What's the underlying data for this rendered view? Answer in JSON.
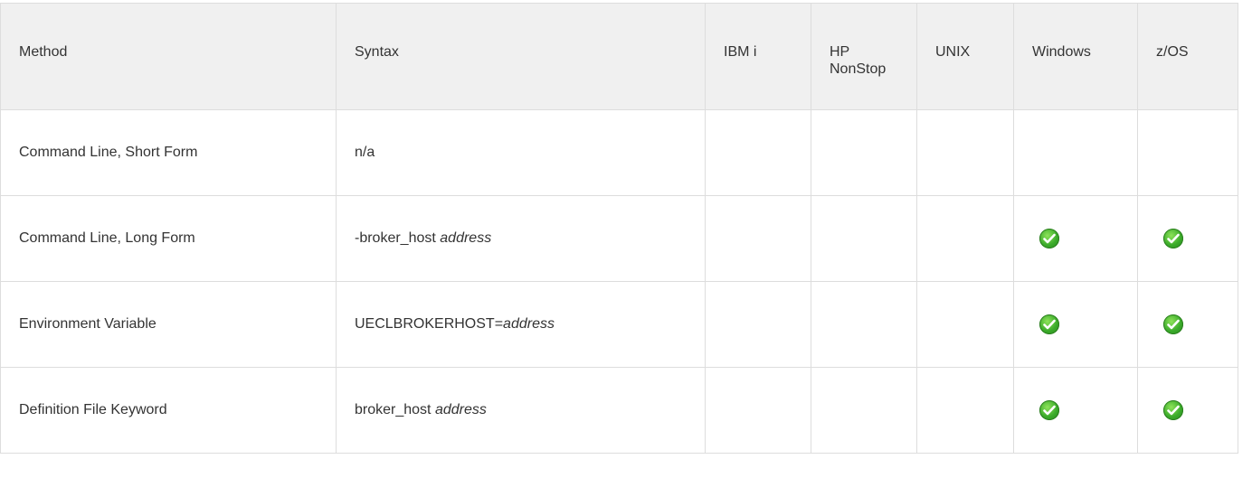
{
  "table": {
    "headers": [
      "Method",
      "Syntax",
      "IBM i",
      "HP\nNonStop",
      "UNIX",
      "Windows",
      "z/OS"
    ],
    "header_hp_line1": "HP",
    "header_hp_line2": "NonStop",
    "rows": [
      {
        "method": "Command Line, Short Form",
        "syntax_pre": "n/a",
        "syntax_arg": "",
        "ibmi": false,
        "hpnonstop": false,
        "unix": false,
        "windows": false,
        "zos": false
      },
      {
        "method": "Command Line, Long Form",
        "syntax_pre": "-broker_host ",
        "syntax_arg": "address",
        "ibmi": false,
        "hpnonstop": false,
        "unix": false,
        "windows": true,
        "zos": true
      },
      {
        "method": "Environment Variable",
        "syntax_pre": "UECLBROKERHOST=",
        "syntax_arg": "address",
        "ibmi": false,
        "hpnonstop": false,
        "unix": false,
        "windows": true,
        "zos": true
      },
      {
        "method": "Definition File Keyword",
        "syntax_pre": "broker_host ",
        "syntax_arg": "address",
        "ibmi": false,
        "hpnonstop": false,
        "unix": false,
        "windows": true,
        "zos": true
      }
    ]
  },
  "icons": {
    "supported": "check-circle-icon"
  },
  "colors": {
    "header_bg": "#f0f0f0",
    "border": "#dddddd",
    "text": "#333333",
    "check_green": "#3aaa2a"
  }
}
